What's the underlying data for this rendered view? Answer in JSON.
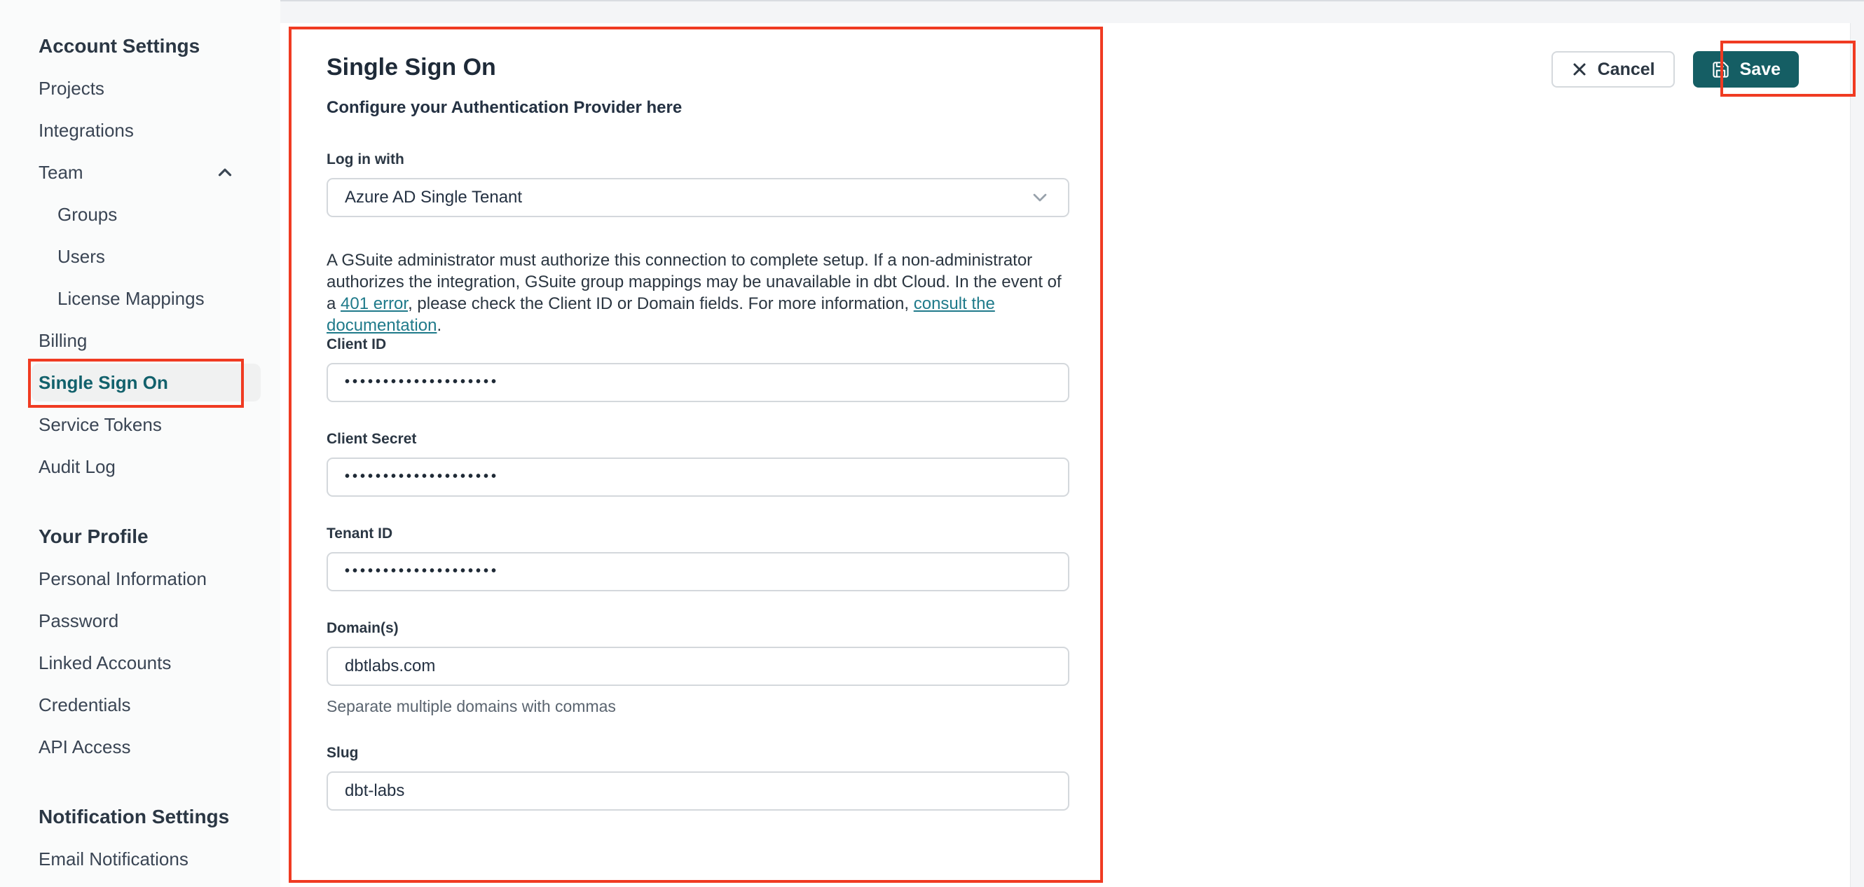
{
  "sidebar": {
    "heading_account": "Account Settings",
    "items": {
      "projects": "Projects",
      "integrations": "Integrations",
      "team": "Team",
      "groups": "Groups",
      "users": "Users",
      "license_mappings": "License Mappings",
      "billing": "Billing",
      "single_sign_on": "Single Sign On",
      "service_tokens": "Service Tokens",
      "audit_log": "Audit Log"
    },
    "heading_profile": "Your Profile",
    "profile_items": {
      "personal_information": "Personal Information",
      "password": "Password",
      "linked_accounts": "Linked Accounts",
      "credentials": "Credentials",
      "api_access": "API Access"
    },
    "heading_notifications": "Notification Settings",
    "notification_items": {
      "email_notifications": "Email Notifications"
    },
    "active_item": "Single Sign On"
  },
  "header": {
    "title": "Single Sign On",
    "subtitle": "Configure your Authentication Provider here",
    "cancel_label": "Cancel",
    "save_label": "Save"
  },
  "form": {
    "login_with": {
      "label": "Log in with",
      "value": "Azure AD Single Tenant"
    },
    "note": {
      "text_1": "A GSuite administrator must authorize this connection to complete setup. If a non-administrator authorizes the integration, GSuite group mappings may be unavailable in dbt Cloud. In the event of a ",
      "link_401": "401 error",
      "text_2": ", please check the Client ID or Domain fields. For more information, ",
      "link_docs": "consult the documentation",
      "text_3": "."
    },
    "fields": {
      "client_id": {
        "label": "Client ID",
        "value": "••••••••••••••••••••"
      },
      "client_secret": {
        "label": "Client Secret",
        "value": "••••••••••••••••••••"
      },
      "tenant_id": {
        "label": "Tenant ID",
        "value": "••••••••••••••••••••"
      },
      "domains": {
        "label": "Domain(s)",
        "value": "dbtlabs.com",
        "helper": "Separate multiple domains with commas"
      },
      "slug": {
        "label": "Slug",
        "value": "dbt-labs"
      }
    }
  },
  "icons": {
    "team_collapse": "chevron-up-icon",
    "select_expand": "chevron-down-icon",
    "cancel": "close-icon",
    "save": "floppy-disk-icon"
  },
  "colors": {
    "brand_teal": "#155e64",
    "active_link_teal": "#12616c",
    "hyperlink_teal": "#1f7a8a",
    "annotation_red": "#f03b22",
    "sidebar_bg": "#fafbfb",
    "top_strip_bg": "#f4f5f7",
    "text_dark": "#1e2a38"
  },
  "annotations": {
    "highlighted_regions": [
      "main-form-area",
      "sidebar-single-sign-on-item",
      "save-button"
    ]
  }
}
